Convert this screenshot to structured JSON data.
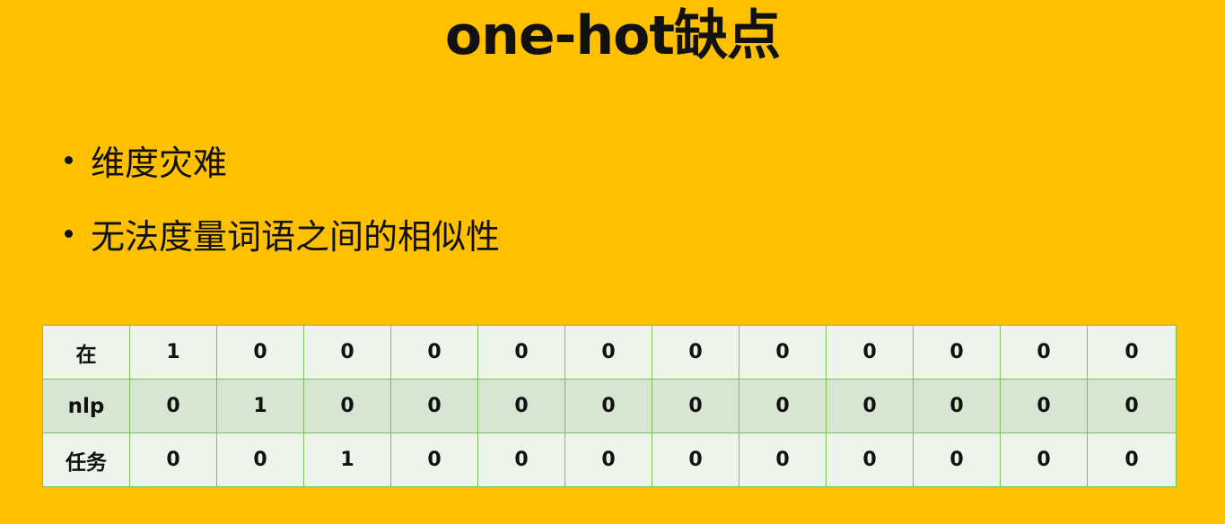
{
  "slide": {
    "title": "one-hot缺点",
    "bullets": [
      "维度灾难",
      "无法度量词语之间的相似性"
    ]
  },
  "table": {
    "rows": [
      {
        "word": "在",
        "vector": [
          "1",
          "0",
          "0",
          "0",
          "0",
          "0",
          "0",
          "0",
          "0",
          "0",
          "0",
          "0"
        ]
      },
      {
        "word": "nlp",
        "vector": [
          "0",
          "1",
          "0",
          "0",
          "0",
          "0",
          "0",
          "0",
          "0",
          "0",
          "0",
          "0"
        ]
      },
      {
        "word": "任务",
        "vector": [
          "0",
          "0",
          "1",
          "0",
          "0",
          "0",
          "0",
          "0",
          "0",
          "0",
          "0",
          "0"
        ]
      }
    ]
  },
  "colors": {
    "background": "#FFC000",
    "table_border": "#7cc05a",
    "row_light": "#eef3ec",
    "row_dark": "#d7e6d3"
  }
}
